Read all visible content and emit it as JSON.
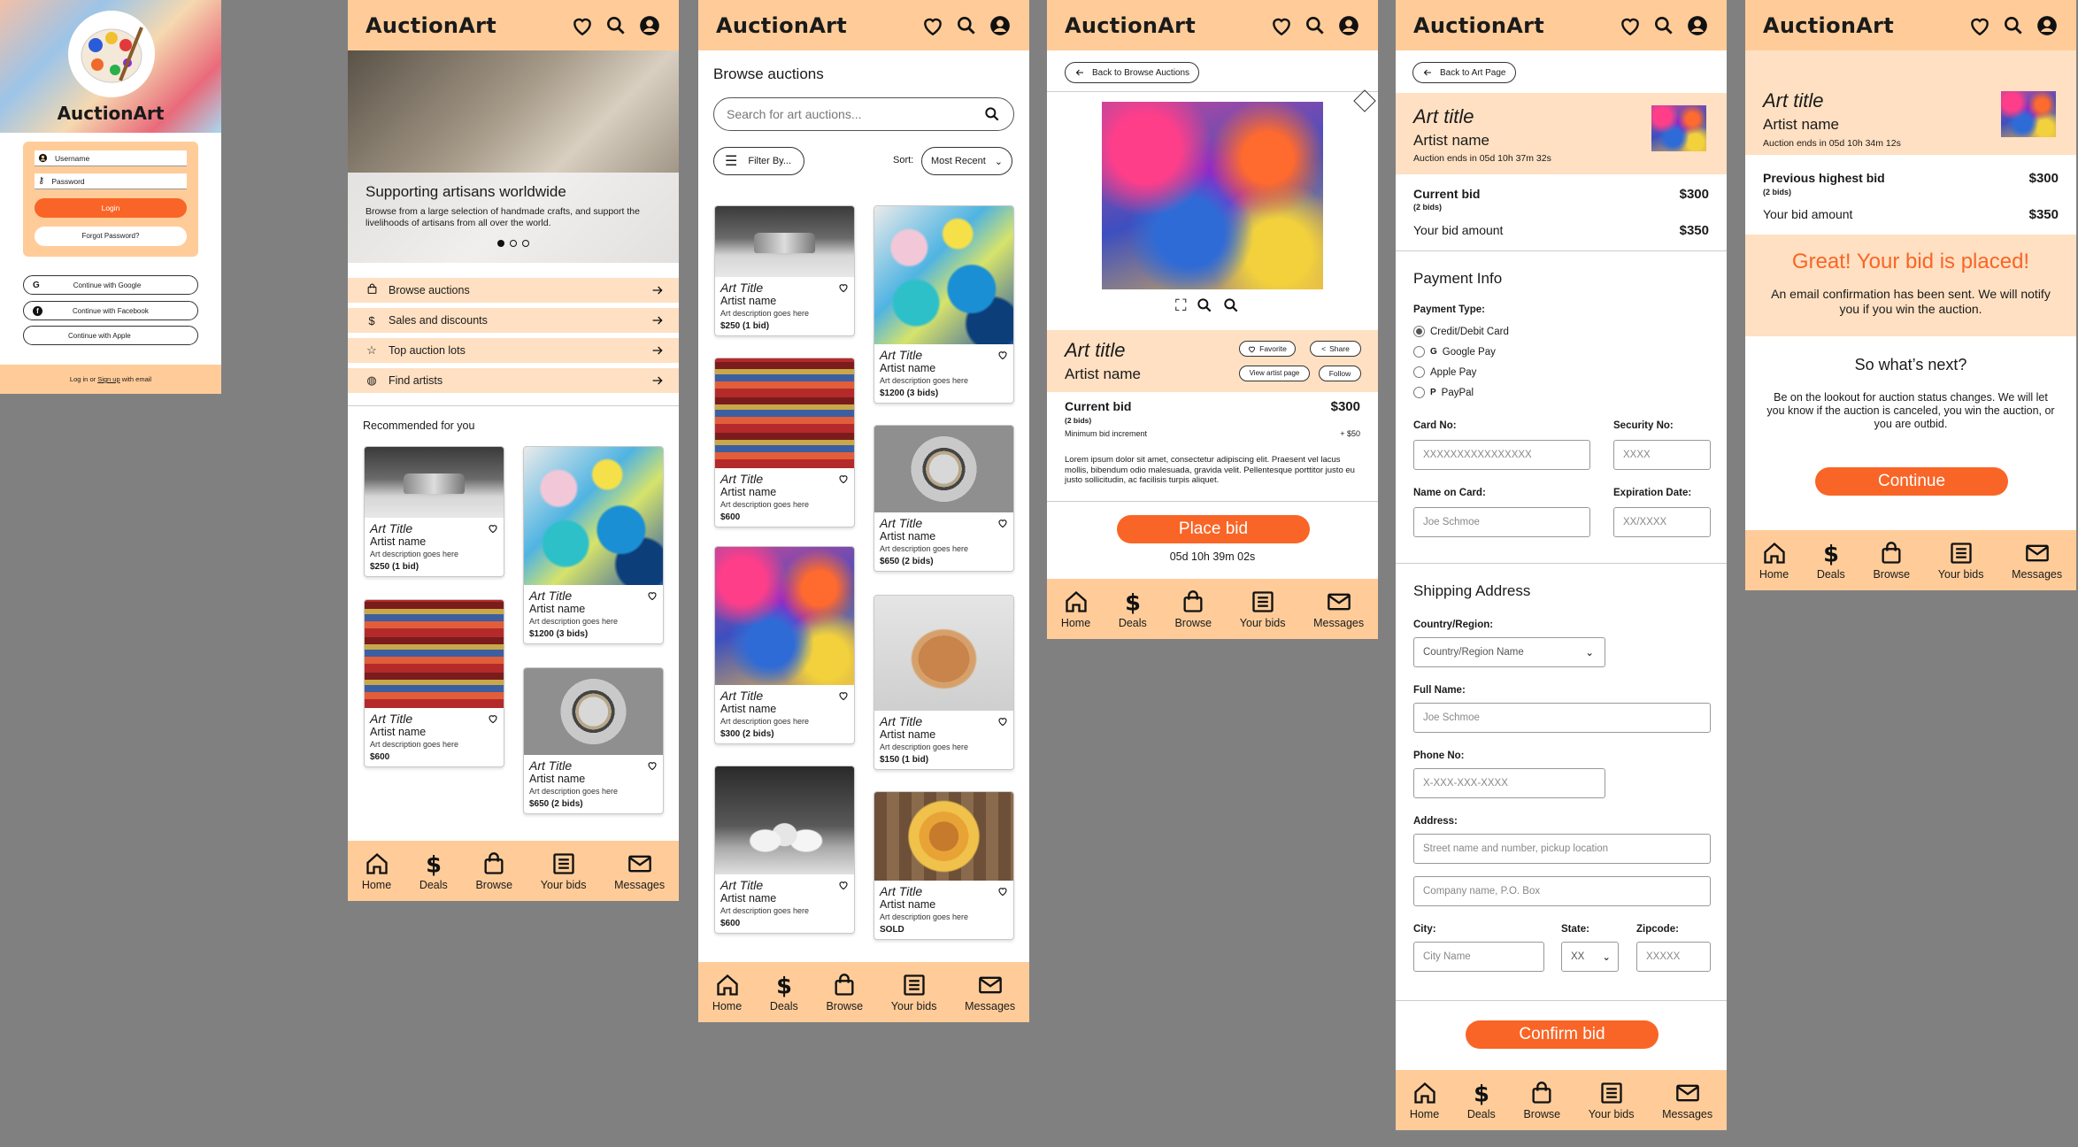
{
  "app": {
    "name": "AuctionArt"
  },
  "nav": [
    {
      "icon": "home-icon",
      "label": "Home"
    },
    {
      "icon": "dollar-icon",
      "label": "Deals"
    },
    {
      "icon": "bag-icon",
      "label": "Browse"
    },
    {
      "icon": "list-icon",
      "label": "Your bids"
    },
    {
      "icon": "mail-icon",
      "label": "Messages"
    }
  ],
  "login": {
    "username": "Username",
    "password": "Password",
    "login": "Login",
    "forgot": "Forgot Password?",
    "google": "Continue with Google",
    "facebook": "Continue with Facebook",
    "apple": "Continue with Apple",
    "footer_pre": "Log in or ",
    "footer_link": "Sign up",
    "footer_post": " with email"
  },
  "home": {
    "hero_title": "Supporting artisans worldwide",
    "hero_desc": "Browse from a large selection of handmade crafts, and support the livelihoods of artisans from all over the world.",
    "menu": [
      "Browse auctions",
      "Sales and discounts",
      "Top auction lots",
      "Find artists"
    ],
    "recommended": "Recommended for you",
    "cards": [
      {
        "title": "Art Title",
        "artist": "Artist name",
        "desc": "Art description goes here",
        "price": "$250 (1 bid)"
      },
      {
        "title": "Art Title",
        "artist": "Artist name",
        "desc": "Art description goes here",
        "price": "$1200 (3 bids)"
      },
      {
        "title": "Art Title",
        "artist": "Artist name",
        "desc": "Art description goes here",
        "price": "$600"
      },
      {
        "title": "Art Title",
        "artist": "Artist name",
        "desc": "Art description goes here",
        "price": "$650 (2 bids)"
      }
    ]
  },
  "browse": {
    "title": "Browse auctions",
    "search_placeholder": "Search for art auctions...",
    "filter": "Filter By...",
    "sort_label": "Sort:",
    "sort_value": "Most Recent",
    "cards": [
      {
        "title": "Art Title",
        "artist": "Artist name",
        "desc": "Art description goes here",
        "price": "$250 (1 bid)"
      },
      {
        "title": "Art Title",
        "artist": "Artist name",
        "desc": "Art description goes here",
        "price": "$1200 (3 bids)"
      },
      {
        "title": "Art Title",
        "artist": "Artist name",
        "desc": "Art description goes here",
        "price": "$600"
      },
      {
        "title": "Art Title",
        "artist": "Artist name",
        "desc": "Art description goes here",
        "price": "$650 (2 bids)"
      },
      {
        "title": "Art Title",
        "artist": "Artist name",
        "desc": "Art description goes here",
        "price": "$300 (2 bids)"
      },
      {
        "title": "Art Title",
        "artist": "Artist name",
        "desc": "Art description goes here",
        "price": "$150 (1 bid)"
      },
      {
        "title": "Art Title",
        "artist": "Artist name",
        "desc": "Art description goes here",
        "price": "$600"
      },
      {
        "title": "Art Title",
        "artist": "Artist name",
        "desc": "Art description goes here",
        "price": "SOLD"
      }
    ]
  },
  "detail": {
    "back": "Back to Browse Auctions",
    "title": "Art title",
    "artist": "Artist name",
    "favorite": "Favorite",
    "share": "Share",
    "view_artist": "View artist page",
    "follow": "Follow",
    "current_bid": "Current bid",
    "current_value": "$300",
    "bids": "(2 bids)",
    "min_inc": "Minimum bid increment",
    "min_inc_value": "+ $50",
    "lorem": "Lorem ipsum dolor sit amet, consectetur adipiscing elit. Praesent vel lacus mollis, bibendum odio malesuada, gravida velit. Pellentesque porttitor justo eu justo sollicitudin, ac facilisis turpis aliquet.",
    "place_bid": "Place bid",
    "timer": "05d 10h 39m 02s"
  },
  "payment": {
    "back": "Back to Art Page",
    "title": "Art title",
    "artist": "Artist name",
    "ends": "Auction ends in 05d 10h 37m 32s",
    "current_bid": "Current bid",
    "current_value": "$300",
    "bids": "(2 bids)",
    "your_bid": "Your bid amount",
    "your_value": "$350",
    "payment_info": "Payment Info",
    "payment_type": "Payment Type:",
    "options": [
      "Credit/Debit Card",
      "Google Pay",
      "Apple Pay",
      "PayPal"
    ],
    "card_no": "Card No:",
    "card_ph": "XXXXXXXXXXXXXXXX",
    "sec_no": "Security No:",
    "sec_ph": "XXXX",
    "name_on_card": "Name on Card:",
    "name_ph": "Joe Schmoe",
    "exp": "Expiration Date:",
    "exp_ph": "XX/XXXX",
    "shipping": "Shipping Address",
    "country": "Country/Region:",
    "country_ph": "Country/Region Name",
    "full_name": "Full Name:",
    "full_ph": "Joe Schmoe",
    "phone": "Phone No:",
    "phone_ph": "X-XXX-XXX-XXXX",
    "address": "Address:",
    "addr1": "Street name and number, pickup location",
    "addr2": "Company name, P.O. Box",
    "city": "City:",
    "city_ph": "City Name",
    "state": "State:",
    "state_ph": "XX",
    "zip": "Zipcode:",
    "zip_ph": "XXXXX",
    "confirm": "Confirm bid"
  },
  "confirm": {
    "title": "Art title",
    "artist": "Artist name",
    "ends": "Auction ends in 05d 10h 34m 12s",
    "prev": "Previous highest bid",
    "prev_value": "$300",
    "bids": "(2 bids)",
    "your_bid": "Your bid amount",
    "your_value": "$350",
    "great": "Great! Your bid is placed!",
    "email": "An email confirmation has been sent. We will notify you if you win the auction.",
    "next": "So what’s next?",
    "next_desc": "Be on the lookout for auction status changes. We will let you know if the auction is canceled, you win the auction, or you are outbid.",
    "continue": "Continue"
  }
}
